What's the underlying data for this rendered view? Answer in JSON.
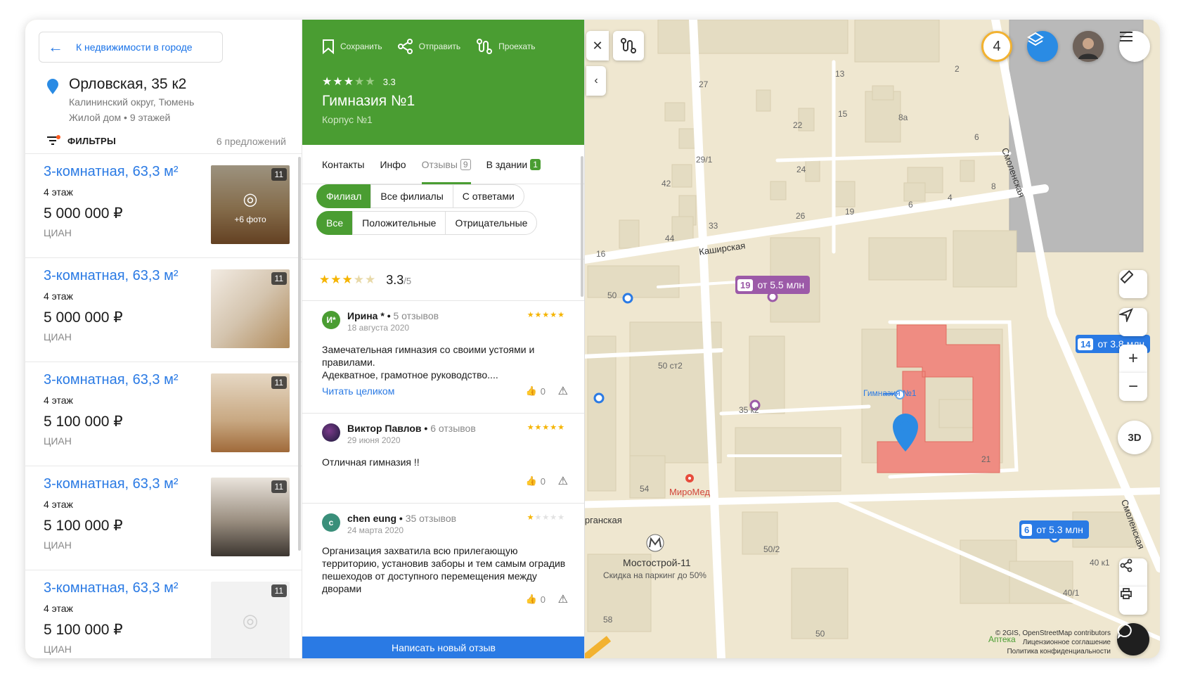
{
  "left": {
    "back_label": "К недвижимости в городе",
    "address": "Орловская, 35 к2",
    "district": "Калининский округ, Тюмень",
    "building": "Жилой дом • 9 этажей",
    "filters_label": "ФИЛЬТРЫ",
    "offers_count": "6 предложений",
    "listings": [
      {
        "title": "3-комнатная, 63,3 м²",
        "floor": "4 этаж",
        "price": "5 000 000 ₽",
        "source": "ЦИАН",
        "photos": "11",
        "extra": "+6 фото"
      },
      {
        "title": "3-комнатная, 63,3 м²",
        "floor": "4 этаж",
        "price": "5 000 000 ₽",
        "source": "ЦИАН",
        "photos": "11"
      },
      {
        "title": "3-комнатная, 63,3 м²",
        "floor": "4 этаж",
        "price": "5 100 000 ₽",
        "source": "ЦИАН",
        "photos": "11"
      },
      {
        "title": "3-комнатная, 63,3 м²",
        "floor": "4 этаж",
        "price": "5 100 000 ₽",
        "source": "ЦИАН",
        "photos": "11"
      },
      {
        "title": "3-комнатная, 63,3 м²",
        "floor": "4 этаж",
        "price": "5 100 000 ₽",
        "source": "ЦИАН",
        "photos": "11"
      }
    ]
  },
  "card": {
    "actions": {
      "save": "Сохранить",
      "share": "Отправить",
      "route": "Проехать"
    },
    "rating_stars": "★★★★★",
    "rating_value": "3.3",
    "title": "Гимназия №1",
    "subtitle": "Корпус №1",
    "tabs": {
      "contacts": "Контакты",
      "info": "Инфо",
      "reviews": "Отзывы",
      "reviews_count": "9",
      "in_building": "В здании",
      "in_building_count": "1"
    },
    "chips_row1": [
      "Филиал",
      "Все филиалы",
      "С ответами"
    ],
    "chips_row2": [
      "Все",
      "Положительные",
      "Отрицательные"
    ],
    "summary_score": "3.3",
    "summary_max": "/5",
    "reviews": [
      {
        "initials": "И*",
        "author": "Ирина *",
        "count": "5 отзывов",
        "date": "18 августа 2020",
        "stars": "★★★★★",
        "text": "Замечательная гимназия со своими устоями и правилами.\nАдекватное, грамотное руководство....",
        "more": "Читать целиком",
        "likes": "0",
        "color": "#4a9d32"
      },
      {
        "initials": "",
        "author": "Виктор Павлов",
        "count": "6 отзывов",
        "date": "29 июня 2020",
        "stars": "★★★★★",
        "text": "Отличная гимназия !!",
        "likes": "0",
        "color": "#3b2a5a"
      },
      {
        "initials": "c",
        "author": "chen eung",
        "count": "35 отзывов",
        "date": "24 марта 2020",
        "stars": "★★★★★",
        "text": "Организация захватила всю прилегающую территорию, установив заборы и тем самым оградив пешеходов от доступного перемещения между дворами",
        "likes": "0",
        "color": "#3a8f7a"
      }
    ],
    "write_review": "Написать новый отзыв"
  },
  "map": {
    "streets": {
      "kashirskaya": "Каширская",
      "smolenskaya1": "Смоленская",
      "smolenskaya2": "Смоленская",
      "kurganskaya": "Курганская"
    },
    "numbers": [
      "27",
      "13",
      "15",
      "8а",
      "2",
      "22",
      "6",
      "29/1",
      "24",
      "42",
      "8",
      "4",
      "26",
      "19",
      "6",
      "33",
      "44",
      "16",
      "50",
      "50 ст2",
      "35 к2",
      "21",
      "54",
      "50/2",
      "40 к1",
      "40/1",
      "58",
      "50"
    ],
    "price_tags": [
      {
        "num": "19",
        "label": "от 5.5 млн",
        "color": "#9c5aa8"
      },
      {
        "num": "14",
        "label": "от 3.8 млн",
        "color": "#2a7ae4"
      },
      {
        "num": "6",
        "label": "от 5.3 млн",
        "color": "#2a7ae4"
      }
    ],
    "pois": {
      "gymnasium": "Гимназия №1",
      "miromed": "МироМед",
      "mostostroy": "Мостострой-11",
      "mostostroy_sub": "Скидка на паркинг до 50%",
      "apteka": "Аптека"
    },
    "filter_count": "4",
    "btn_3d": "3D",
    "copyright": [
      "© 2GIS, OpenStreetMap contributors",
      "Лицензионное соглашение",
      "Политика конфиденциальности"
    ],
    "colors": {
      "building_highlight": "#ef8c82",
      "map_bg": "#efe7d0",
      "road": "#ffffff",
      "block": "#e4dcc2"
    }
  }
}
